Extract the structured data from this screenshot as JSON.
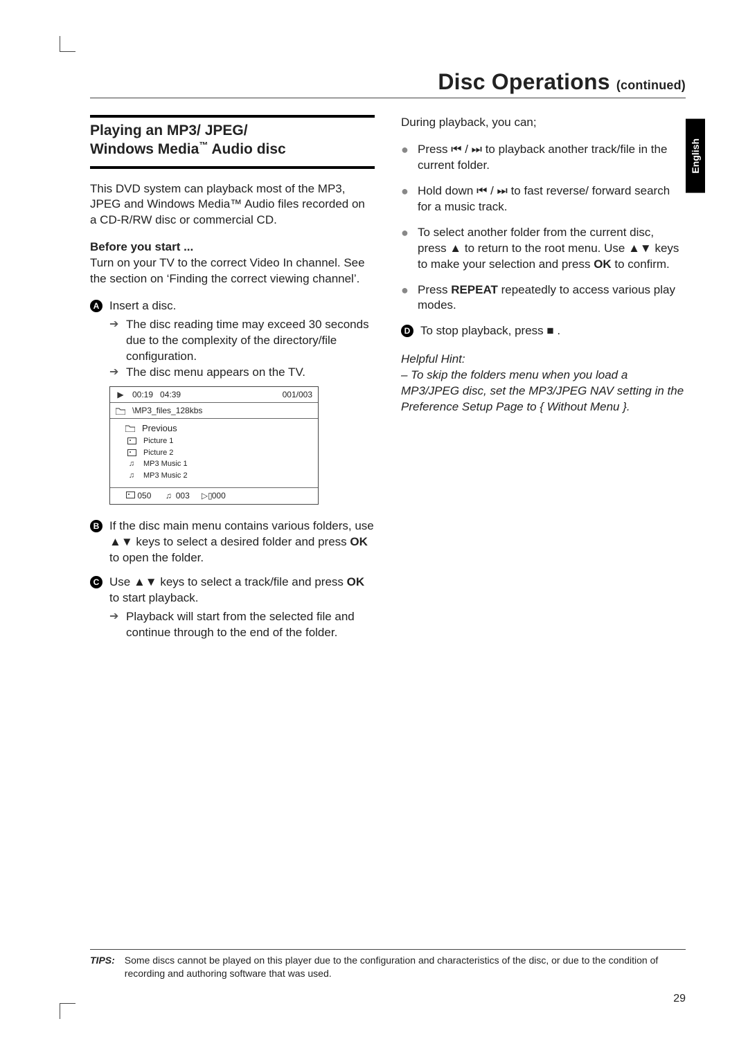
{
  "header": {
    "title": "Disc Operations",
    "continued": "(continued)"
  },
  "language_tab": "English",
  "left": {
    "section_title_l1": "Playing an MP3/ JPEG/",
    "section_title_l2_pre": "Windows Media",
    "section_title_l2_tm": "™",
    "section_title_l2_post": " Audio disc",
    "intro": "This DVD system can playback most of the MP3, JPEG and Windows Media™ Audio files recorded on a CD-R/RW disc or commercial CD.",
    "before_head": "Before you start ...",
    "before_text": "Turn on your TV to the correct Video In channel.  See the section on ‘Finding the correct viewing channel’.",
    "step1": {
      "num": "A",
      "text": "Insert a disc.",
      "sub1": "The disc reading time may exceed 30 seconds due to the complexity of the directory/file configuration.",
      "sub2": "The disc menu appears on the TV."
    },
    "menu": {
      "time1": "00:19",
      "time2": "04:39",
      "track_index": "001/003",
      "path": "\\MP3_files_128kbs",
      "items": [
        {
          "icon": "folder",
          "label": "Previous"
        },
        {
          "icon": "photo",
          "label": "Picture 1"
        },
        {
          "icon": "photo",
          "label": "Picture 2"
        },
        {
          "icon": "music",
          "label": "MP3 Music 1"
        },
        {
          "icon": "music",
          "label": "MP3 Music 2"
        }
      ],
      "footer": {
        "photos": "050",
        "music": "003",
        "videos": "000"
      }
    },
    "step2": {
      "num": "B",
      "pre": "If the disc main menu contains various folders, use ",
      "mid": " keys to select a desired folder and press ",
      "ok": "OK",
      "post": " to open the folder."
    },
    "step3": {
      "num": "C",
      "pre": "Use ",
      "mid": " keys to select a track/file and press ",
      "ok": "OK",
      "post": " to start playback.",
      "sub": "Playback will start from the selected file and continue through to the end of the folder."
    }
  },
  "right": {
    "lead": "During playback, you can;",
    "b1": {
      "pre": "Press ",
      "mid": " / ",
      "post": " to playback another track/file in the current folder."
    },
    "b2": {
      "pre": "Hold down ",
      "mid": " / ",
      "post": " to fast reverse/ forward search for a music track."
    },
    "b3": {
      "pre": "To select another folder from the current disc, press ",
      "mid": " to return to the root menu.  Use ",
      "mid2": " keys to make your selection and press ",
      "ok": "OK",
      "post": " to confirm."
    },
    "b4": {
      "pre": "Press ",
      "repeat": "REPEAT",
      "post": " repeatedly to access various play modes."
    },
    "step4": {
      "num": "D",
      "pre": "To stop playback, press ",
      "post": " ."
    },
    "hint_head": "Helpful Hint:",
    "hint_body": "– To skip the folders menu when you load a MP3/JPEG disc, set the MP3/JPEG NAV setting in the Preference Setup Page to          { Without Menu }."
  },
  "footer": {
    "tips_label": "TIPS:",
    "tips_text": "Some discs cannot be played on this player due to the configuration and characteristics of the disc, or due to the condition of recording and authoring software that was used."
  },
  "page_number": "29"
}
